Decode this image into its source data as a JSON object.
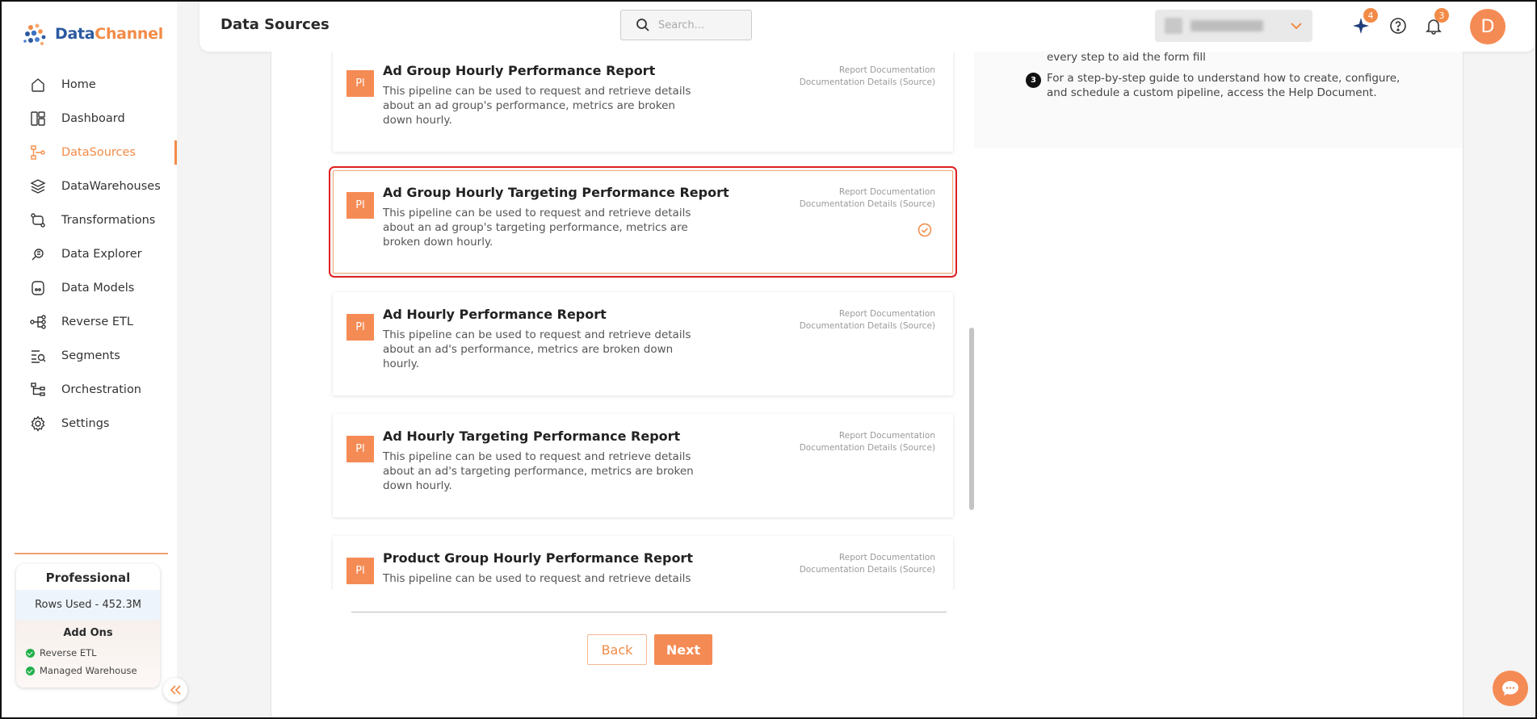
{
  "brand": {
    "name_part1": "Data",
    "name_part2": "Channel"
  },
  "header": {
    "title": "Data Sources",
    "search_placeholder": "Search...",
    "sparkle_badge": "4",
    "bell_badge": "3",
    "avatar_initial": "D"
  },
  "sidebar": {
    "items": [
      {
        "label": "Home",
        "icon": "home-icon"
      },
      {
        "label": "Dashboard",
        "icon": "dashboard-icon"
      },
      {
        "label": "DataSources",
        "icon": "datasources-icon"
      },
      {
        "label": "DataWarehouses",
        "icon": "datawarehouses-icon"
      },
      {
        "label": "Transformations",
        "icon": "transformations-icon"
      },
      {
        "label": "Data Explorer",
        "icon": "data-explorer-icon"
      },
      {
        "label": "Data Models",
        "icon": "data-models-icon"
      },
      {
        "label": "Reverse ETL",
        "icon": "reverse-etl-icon"
      },
      {
        "label": "Segments",
        "icon": "segments-icon"
      },
      {
        "label": "Orchestration",
        "icon": "orchestration-icon"
      },
      {
        "label": "Settings",
        "icon": "settings-icon"
      }
    ],
    "active_index": 2,
    "plan": {
      "title": "Professional",
      "rows_used": "Rows Used - 452.3M",
      "addons_title": "Add Ons",
      "addons": [
        "Reverse ETL",
        "Managed Warehouse"
      ]
    }
  },
  "reports": [
    {
      "icon_text": "Pl",
      "title": "Ad Group Hourly Performance Report",
      "description": "This pipeline can be used to request and retrieve details about an ad group's performance, metrics are broken down hourly.",
      "link1": "Report Documentation",
      "link2": "Documentation Details (Source)",
      "selected": false
    },
    {
      "icon_text": "Pl",
      "title": "Ad Group Hourly Targeting Performance Report",
      "description": "This pipeline can be used to request and retrieve details about an ad group's targeting performance, metrics are broken down hourly.",
      "link1": "Report Documentation",
      "link2": "Documentation Details (Source)",
      "selected": true
    },
    {
      "icon_text": "Pl",
      "title": "Ad Hourly Performance Report",
      "description": "This pipeline can be used to request and retrieve details about an ad's performance, metrics are broken down hourly.",
      "link1": "Report Documentation",
      "link2": "Documentation Details (Source)",
      "selected": false
    },
    {
      "icon_text": "Pl",
      "title": "Ad Hourly Targeting Performance Report",
      "description": "This pipeline can be used to request and retrieve details about an ad's targeting performance, metrics are broken down hourly.",
      "link1": "Report Documentation",
      "link2": "Documentation Details (Source)",
      "selected": false
    },
    {
      "icon_text": "Pl",
      "title": "Product Group Hourly Performance Report",
      "description": "This pipeline can be used to request and retrieve details",
      "link1": "Report Documentation",
      "link2": "Documentation Details (Source)",
      "selected": false
    }
  ],
  "buttons": {
    "back": "Back",
    "next": "Next"
  },
  "help": {
    "step2_tail": "every step to aid the form fill",
    "step3_number": "3",
    "step3_text": "For a step-by-step guide to understand how to create, configure, and schedule a custom pipeline, access the Help Document."
  },
  "colors": {
    "accent": "#f58b54",
    "selection": "#e02020",
    "brand_blue": "#2c5aa0"
  }
}
